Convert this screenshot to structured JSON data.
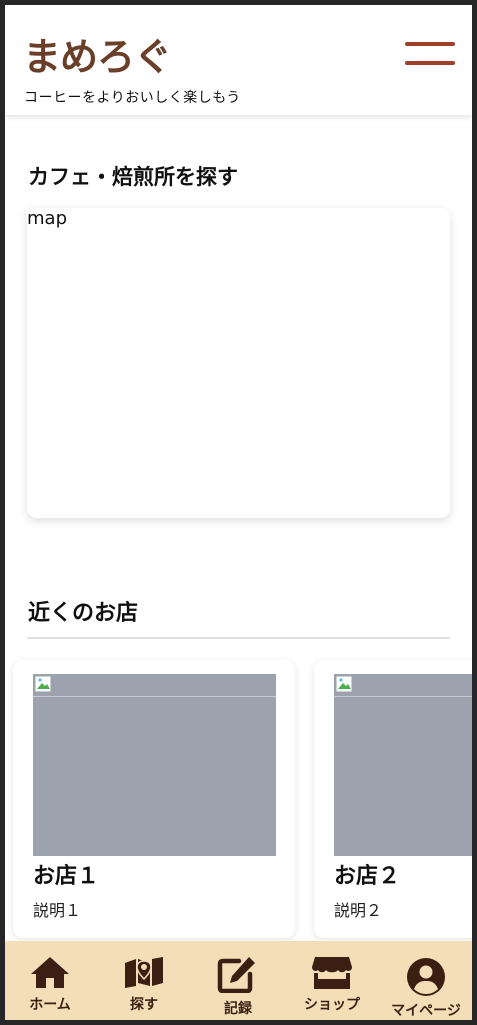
{
  "header": {
    "logo_text": "まめろぐ",
    "tagline": "コーヒーをよりおいしく楽しもう",
    "menu_icon": "hamburger-menu-icon",
    "brand_color": "#6b3e2a",
    "accent_color": "#9e3f2a"
  },
  "search_section": {
    "title": "カフェ・焙煎所を探す",
    "map_placeholder": "map"
  },
  "nearby_section": {
    "title": "近くのお店",
    "shops": [
      {
        "name": "お店１",
        "description": "説明１",
        "image_icon": "broken-image-icon"
      },
      {
        "name": "お店２",
        "description": "説明２",
        "image_icon": "broken-image-icon"
      }
    ]
  },
  "bottom_nav": {
    "background": "#f3deb7",
    "items": [
      {
        "label": "ホーム",
        "icon": "home-icon"
      },
      {
        "label": "探す",
        "icon": "map-icon"
      },
      {
        "label": "記録",
        "icon": "edit-icon"
      },
      {
        "label": "ショップ",
        "icon": "store-icon"
      },
      {
        "label": "マイページ",
        "icon": "user-circle-icon"
      }
    ]
  }
}
